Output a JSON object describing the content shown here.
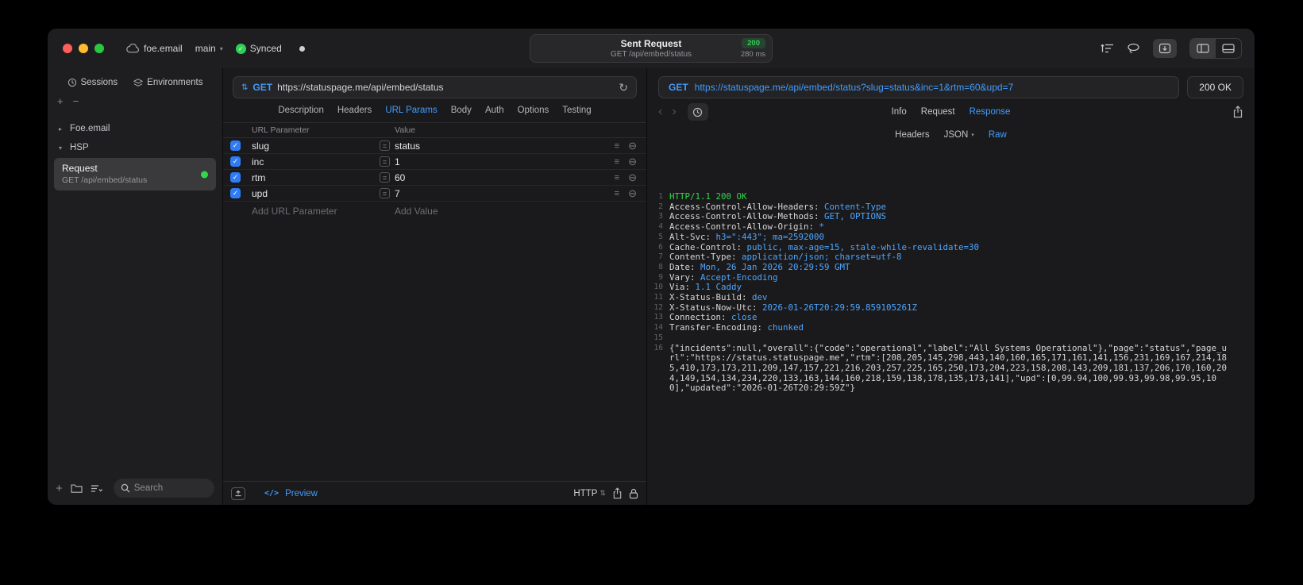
{
  "icons": {
    "chevron_down": "▾",
    "chevron_right": "▸",
    "back": "‹",
    "forward": "›",
    "plus": "+",
    "minus": "−",
    "check": "✓",
    "refresh": "↻",
    "equals": "=",
    "hamburger": "≡",
    "remove_circle": "⊖",
    "code": "</>",
    "method_updown": "⇅"
  },
  "titlebar": {
    "account": "foe.email",
    "branch": "main",
    "sync_label": "Synced",
    "request_summary": {
      "title": "Sent Request",
      "status_code": "200",
      "subtitle": "GET /api/embed/status",
      "duration": "280 ms"
    }
  },
  "sidebar": {
    "tabs": [
      {
        "label": "Sessions"
      },
      {
        "label": "Environments"
      }
    ],
    "groups": [
      {
        "label": "Foe.email"
      },
      {
        "label": "HSP"
      }
    ],
    "request_item": {
      "title": "Request",
      "subtitle": "GET /api/embed/status"
    },
    "search_placeholder": "Search"
  },
  "request_pane": {
    "method": "GET",
    "url": "https://statuspage.me/api/embed/status",
    "tabs": [
      {
        "label": "Description"
      },
      {
        "label": "Headers"
      },
      {
        "label": "URL Params",
        "active": true
      },
      {
        "label": "Body"
      },
      {
        "label": "Auth"
      },
      {
        "label": "Options"
      },
      {
        "label": "Testing"
      }
    ],
    "params": {
      "col_key": "URL Parameter",
      "col_value": "Value",
      "rows": [
        {
          "key": "slug",
          "value": "status",
          "checked": true
        },
        {
          "key": "inc",
          "value": "1",
          "checked": true
        },
        {
          "key": "rtm",
          "value": "60",
          "checked": true
        },
        {
          "key": "upd",
          "value": "7",
          "checked": true
        }
      ],
      "add_key": "Add URL Parameter",
      "add_value": "Add Value"
    },
    "footer": {
      "preview": "Preview",
      "protocol": "HTTP"
    }
  },
  "response_pane": {
    "method": "GET",
    "url": "https://statuspage.me/api/embed/status?slug=status&inc=1&rtm=60&upd=7",
    "status": "200 OK",
    "tabs": [
      {
        "label": "Info"
      },
      {
        "label": "Request"
      },
      {
        "label": "Response",
        "active": true
      }
    ],
    "subtabs": [
      {
        "label": "Headers"
      },
      {
        "label": "JSON",
        "chevron": true
      },
      {
        "label": "Raw",
        "active": true
      }
    ],
    "body_lines": [
      {
        "n": 1,
        "segs": [
          {
            "t": "HTTP/1.1 200 OK",
            "c": "green"
          }
        ]
      },
      {
        "n": 2,
        "segs": [
          {
            "t": "Access-Control-Allow-Headers: ",
            "c": "plain"
          },
          {
            "t": "Content-Type",
            "c": "blue"
          }
        ]
      },
      {
        "n": 3,
        "segs": [
          {
            "t": "Access-Control-Allow-Methods: ",
            "c": "plain"
          },
          {
            "t": "GET, OPTIONS",
            "c": "blue"
          }
        ]
      },
      {
        "n": 4,
        "segs": [
          {
            "t": "Access-Control-Allow-Origin: ",
            "c": "plain"
          },
          {
            "t": "*",
            "c": "blue"
          }
        ]
      },
      {
        "n": 5,
        "segs": [
          {
            "t": "Alt-Svc: ",
            "c": "plain"
          },
          {
            "t": "h3=\":443\"; ma=2592000",
            "c": "blue"
          }
        ]
      },
      {
        "n": 6,
        "segs": [
          {
            "t": "Cache-Control: ",
            "c": "plain"
          },
          {
            "t": "public, max-age=15, stale-while-revalidate=30",
            "c": "blue"
          }
        ]
      },
      {
        "n": 7,
        "segs": [
          {
            "t": "Content-Type: ",
            "c": "plain"
          },
          {
            "t": "application/json; charset=utf-8",
            "c": "blue"
          }
        ]
      },
      {
        "n": 8,
        "segs": [
          {
            "t": "Date: ",
            "c": "plain"
          },
          {
            "t": "Mon, 26 Jan 2026 20:29:59 GMT",
            "c": "blue"
          }
        ]
      },
      {
        "n": 9,
        "segs": [
          {
            "t": "Vary: ",
            "c": "plain"
          },
          {
            "t": "Accept-Encoding",
            "c": "blue"
          }
        ]
      },
      {
        "n": 10,
        "segs": [
          {
            "t": "Via: ",
            "c": "plain"
          },
          {
            "t": "1.1 Caddy",
            "c": "blue"
          }
        ]
      },
      {
        "n": 11,
        "segs": [
          {
            "t": "X-Status-Build: ",
            "c": "plain"
          },
          {
            "t": "dev",
            "c": "blue"
          }
        ]
      },
      {
        "n": 12,
        "segs": [
          {
            "t": "X-Status-Now-Utc: ",
            "c": "plain"
          },
          {
            "t": "2026-01-26T20:29:59.859105261Z",
            "c": "blue"
          }
        ]
      },
      {
        "n": 13,
        "segs": [
          {
            "t": "Connection: ",
            "c": "plain"
          },
          {
            "t": "close",
            "c": "blue"
          }
        ]
      },
      {
        "n": 14,
        "segs": [
          {
            "t": "Transfer-Encoding: ",
            "c": "plain"
          },
          {
            "t": "chunked",
            "c": "blue"
          }
        ]
      },
      {
        "n": 15,
        "segs": []
      },
      {
        "n": 16,
        "segs": [
          {
            "t": "{\"incidents\":null,\"overall\":{\"code\":\"operational\",\"label\":\"All Systems Operational\"},\"page\":\"status\",\"page_url\":\"https://status.statuspage.me\",\"rtm\":[208,205,145,298,443,140,160,165,171,161,141,156,231,169,167,214,185,410,173,173,211,209,147,157,221,216,203,257,225,165,250,173,204,223,158,208,143,209,181,137,206,170,160,204,149,154,134,234,220,133,163,144,160,218,159,138,178,135,173,141],\"upd\":[0,99.94,100,99.93,99.98,99.95,100],\"updated\":\"2026-01-26T20:29:59Z\"}",
            "c": "plain"
          }
        ]
      }
    ]
  },
  "colors": {
    "accent": "#409cff",
    "green": "#30d158",
    "checkbox_blue": "#2f7cf6"
  }
}
